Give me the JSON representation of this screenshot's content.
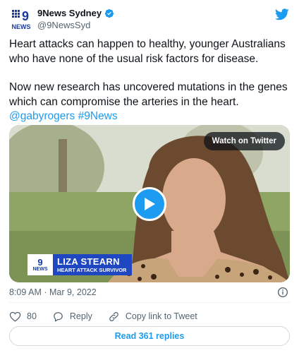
{
  "account": {
    "name": "9News Sydney",
    "handle": "@9NewsSyd",
    "avatar_nine": "9",
    "avatar_news": "NEWS"
  },
  "tweet": {
    "paragraph1": "Heart attacks can happen to healthy, younger Australians who have none of the usual risk factors for disease.",
    "paragraph2": "Now new research has uncovered mutations in the genes which can compromise the arteries in the heart.",
    "mention": "@gabyrogers",
    "hashtag": "#9News"
  },
  "media": {
    "watch_label": "Watch on Twitter",
    "lower_third_logo_nine": "9",
    "lower_third_logo_news": "NEWS",
    "lower_third_name": "LIZA STEARN",
    "lower_third_role": "HEART ATTACK SURVIVOR"
  },
  "timestamp": "8:09 AM · Mar 9, 2022",
  "actions": {
    "like_count": "80",
    "reply_label": "Reply",
    "copy_label": "Copy link to Tweet"
  },
  "replies_button": "Read 361 replies",
  "colors": {
    "accent": "#1d9bf0",
    "text": "#0f1419",
    "muted": "#536471",
    "lower_third_bg": "#1f47c2"
  }
}
